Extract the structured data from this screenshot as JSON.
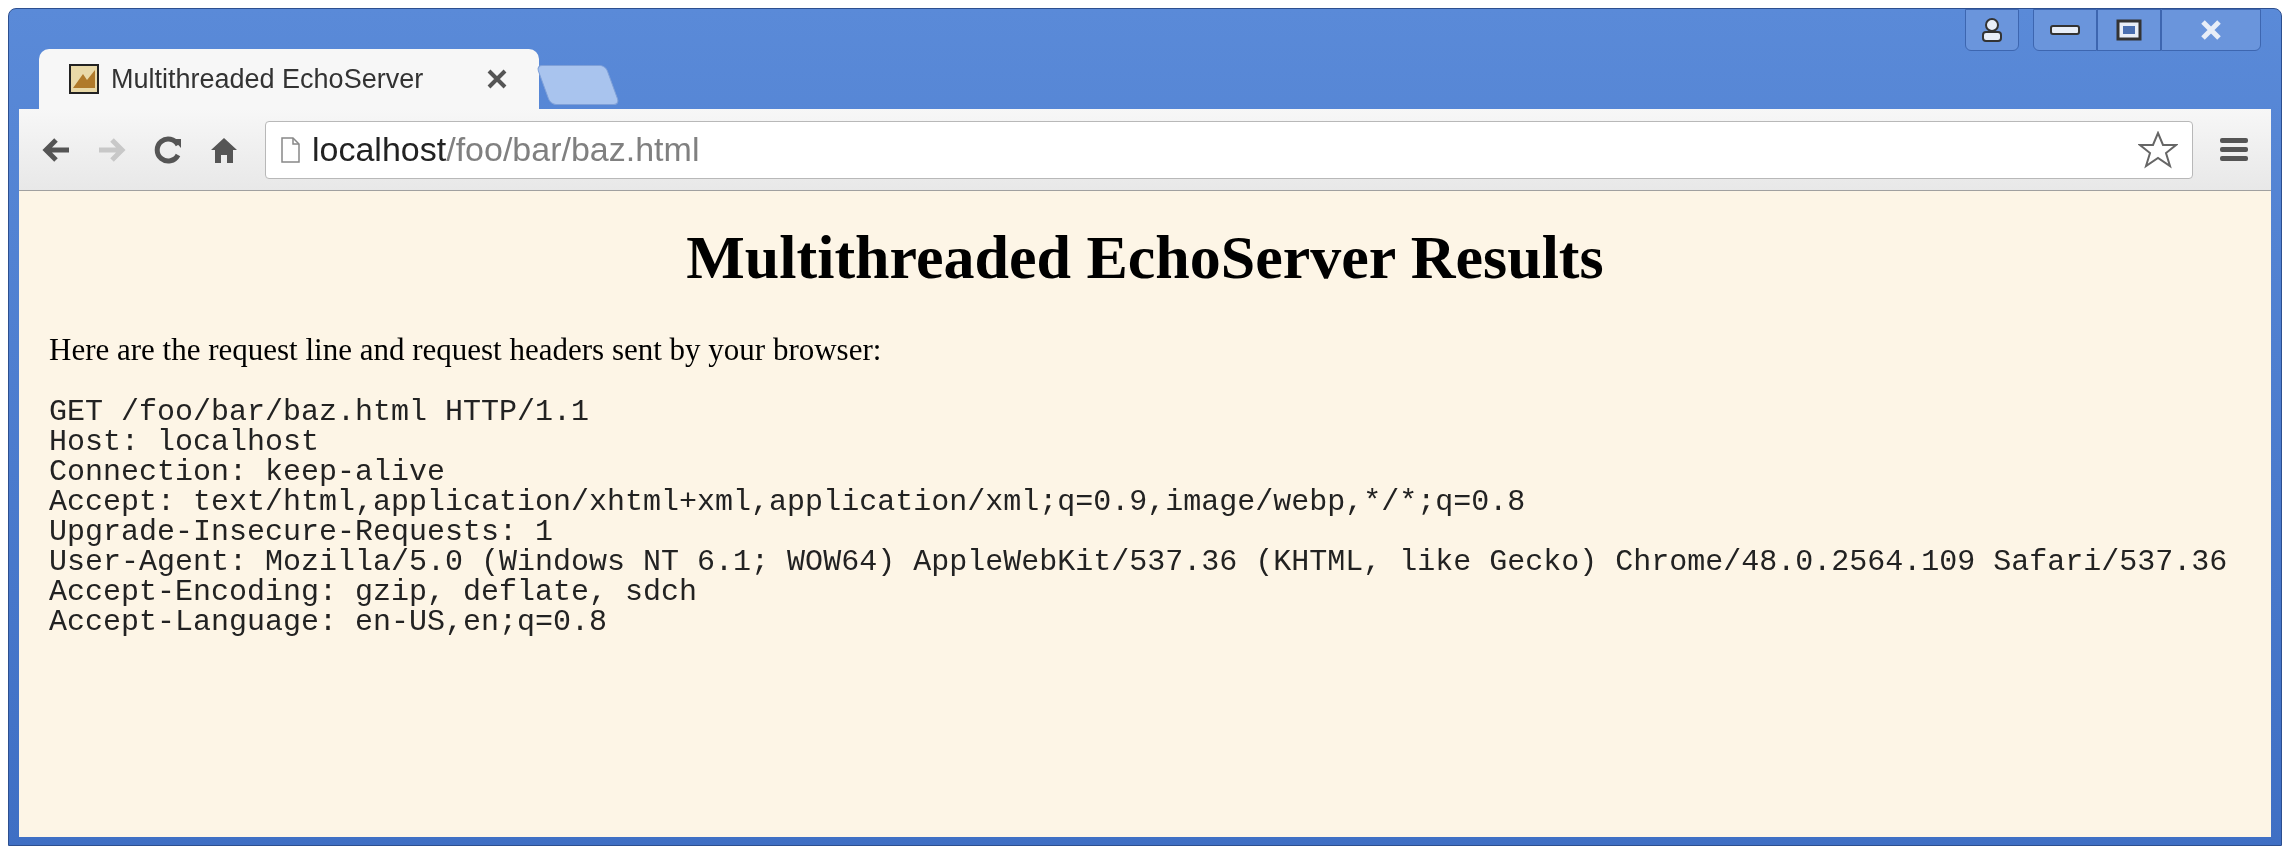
{
  "tabs": [
    {
      "title": "Multithreaded EchoServer",
      "selected": true
    }
  ],
  "address_bar": {
    "host": "localhost",
    "path": "/foo/bar/baz.html"
  },
  "toolbar": {
    "forward_disabled": true
  },
  "page": {
    "heading": "Multithreaded EchoServer Results",
    "intro": "Here are the request line and request headers sent by your browser:",
    "request_lines": [
      "GET /foo/bar/baz.html HTTP/1.1",
      "Host: localhost",
      "Connection: keep-alive",
      "Accept: text/html,application/xhtml+xml,application/xml;q=0.9,image/webp,*/*;q=0.8",
      "Upgrade-Insecure-Requests: 1",
      "User-Agent: Mozilla/5.0 (Windows NT 6.1; WOW64) AppleWebKit/537.36 (KHTML, like Gecko) Chrome/48.0.2564.109 Safari/537.36",
      "Accept-Encoding: gzip, deflate, sdch",
      "Accept-Language: en-US,en;q=0.8"
    ]
  }
}
